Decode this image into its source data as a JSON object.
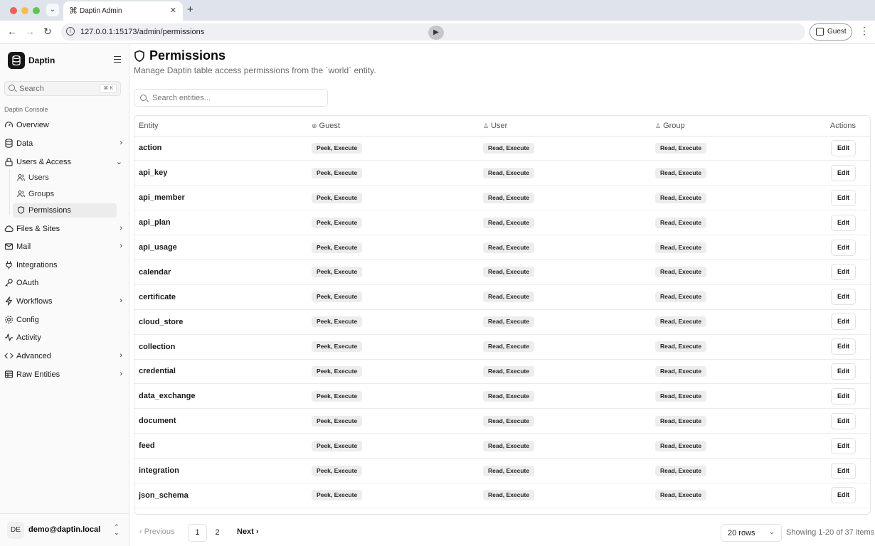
{
  "browser": {
    "tab_title": "Daptin Admin",
    "url": "127.0.0.1:15173/admin/permissions",
    "profile_label": "Guest"
  },
  "sidebar": {
    "brand": "Daptin",
    "search_placeholder": "Search",
    "search_shortcut": "⌘ K",
    "group_label": "Daptin Console",
    "items": [
      {
        "label": "Overview",
        "icon": "gauge-icon"
      },
      {
        "label": "Data",
        "icon": "database-icon"
      },
      {
        "label": "Users & Access",
        "icon": "lock-icon",
        "expanded": true
      },
      {
        "label": "Files & Sites",
        "icon": "cloud-icon"
      },
      {
        "label": "Mail",
        "icon": "mail-icon"
      },
      {
        "label": "Integrations",
        "icon": "plug-icon"
      },
      {
        "label": "OAuth",
        "icon": "key-icon"
      },
      {
        "label": "Workflows",
        "icon": "workflow-icon"
      },
      {
        "label": "Config",
        "icon": "gear-icon"
      },
      {
        "label": "Activity",
        "icon": "activity-icon"
      },
      {
        "label": "Advanced",
        "icon": "code-icon"
      },
      {
        "label": "Raw Entities",
        "icon": "table-icon"
      }
    ],
    "sub_items": [
      {
        "label": "Users",
        "icon": "users-icon"
      },
      {
        "label": "Groups",
        "icon": "group-icon"
      },
      {
        "label": "Permissions",
        "icon": "shield-icon",
        "active": true
      }
    ],
    "user": {
      "initials": "DE",
      "email": "demo@daptin.local"
    }
  },
  "main": {
    "title": "Permissions",
    "subtitle": "Manage Daptin table access permissions from the `world` entity.",
    "search_placeholder": "Search entities...",
    "columns": [
      "Entity",
      "Guest",
      "User",
      "Group",
      "Actions"
    ],
    "rows": [
      {
        "entity": "action",
        "guest": "Peek, Execute",
        "user": "Read, Execute",
        "group": "Read, Execute"
      },
      {
        "entity": "api_key",
        "guest": "Peek, Execute",
        "user": "Read, Execute",
        "group": "Read, Execute"
      },
      {
        "entity": "api_member",
        "guest": "Peek, Execute",
        "user": "Read, Execute",
        "group": "Read, Execute"
      },
      {
        "entity": "api_plan",
        "guest": "Peek, Execute",
        "user": "Read, Execute",
        "group": "Read, Execute"
      },
      {
        "entity": "api_usage",
        "guest": "Peek, Execute",
        "user": "Read, Execute",
        "group": "Read, Execute"
      },
      {
        "entity": "calendar",
        "guest": "Peek, Execute",
        "user": "Read, Execute",
        "group": "Read, Execute"
      },
      {
        "entity": "certificate",
        "guest": "Peek, Execute",
        "user": "Read, Execute",
        "group": "Read, Execute"
      },
      {
        "entity": "cloud_store",
        "guest": "Peek, Execute",
        "user": "Read, Execute",
        "group": "Read, Execute"
      },
      {
        "entity": "collection",
        "guest": "Peek, Execute",
        "user": "Read, Execute",
        "group": "Read, Execute"
      },
      {
        "entity": "credential",
        "guest": "Peek, Execute",
        "user": "Read, Execute",
        "group": "Read, Execute"
      },
      {
        "entity": "data_exchange",
        "guest": "Peek, Execute",
        "user": "Read, Execute",
        "group": "Read, Execute"
      },
      {
        "entity": "document",
        "guest": "Peek, Execute",
        "user": "Read, Execute",
        "group": "Read, Execute"
      },
      {
        "entity": "feed",
        "guest": "Peek, Execute",
        "user": "Read, Execute",
        "group": "Read, Execute"
      },
      {
        "entity": "integration",
        "guest": "Peek, Execute",
        "user": "Read, Execute",
        "group": "Read, Execute"
      },
      {
        "entity": "json_schema",
        "guest": "Peek, Execute",
        "user": "Read, Execute",
        "group": "Read, Execute"
      }
    ],
    "edit_label": "Edit"
  },
  "pagination": {
    "previous": "Previous",
    "pages": [
      "1",
      "2"
    ],
    "current_page": "1",
    "next": "Next",
    "rows_option": "20 rows",
    "showing": "Showing 1-20 of 37 items"
  }
}
